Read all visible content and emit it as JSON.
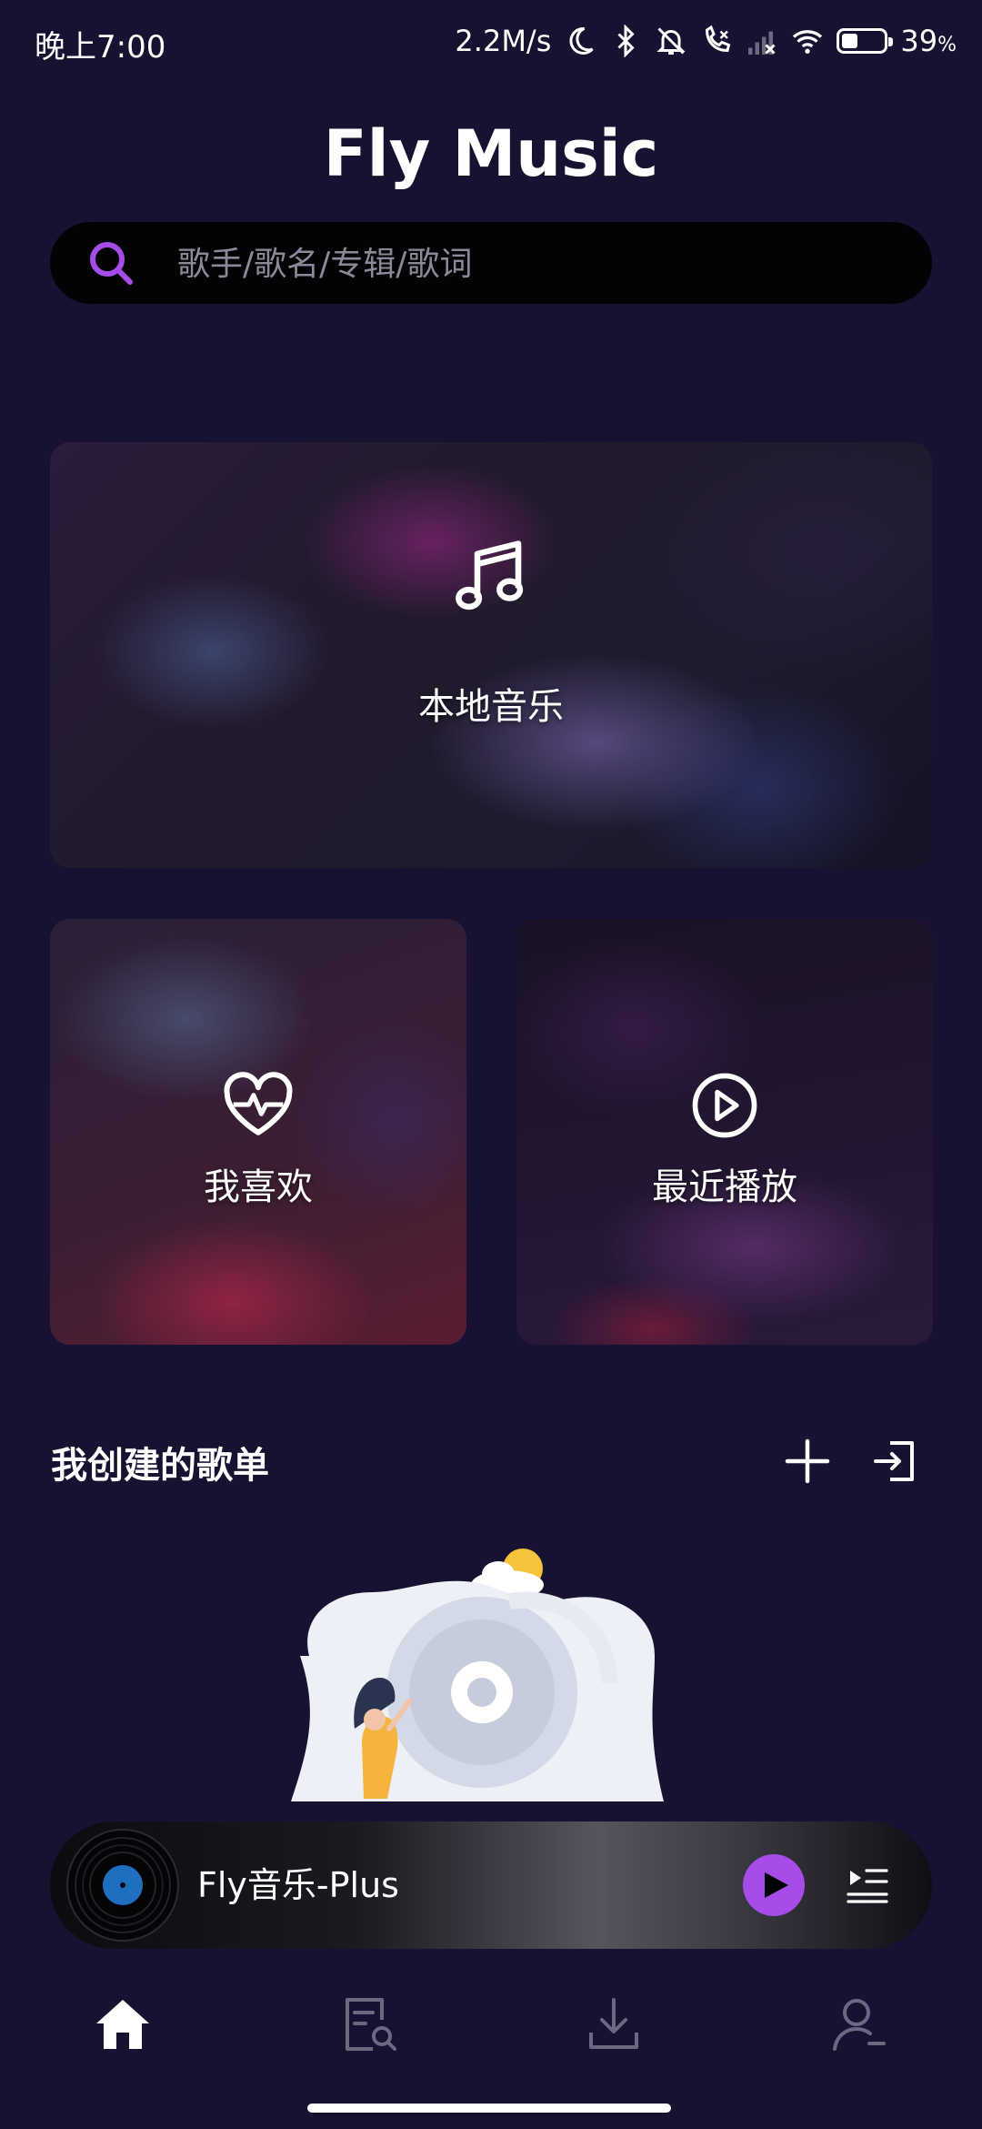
{
  "status_bar": {
    "time": "晚上7:00",
    "network_speed": "2.2M/s",
    "battery_percent_text": "39",
    "battery_percent_suffix": "%",
    "battery_level": 0.39,
    "icons": [
      "moon-icon",
      "bluetooth-icon",
      "mute-icon",
      "call-off-icon",
      "signal-off-icon",
      "wifi-icon",
      "battery-icon"
    ]
  },
  "app": {
    "title": "Fly Music"
  },
  "search": {
    "placeholder": "歌手/歌名/专辑/歌词"
  },
  "cards": {
    "local_music": "本地音乐",
    "favorites": "我喜欢",
    "recent": "最近播放"
  },
  "playlists": {
    "section_title": "我创建的歌单",
    "actions": [
      "plus-icon",
      "import-icon"
    ]
  },
  "player": {
    "song_title": "Fly音乐-Plus"
  },
  "bottom_nav": {
    "items": [
      "home-icon",
      "search-list-icon",
      "download-icon",
      "profile-icon"
    ],
    "active": "home-icon"
  },
  "colors": {
    "background": "#171232",
    "accent": "#a54de6",
    "search_bar": "#030205"
  }
}
